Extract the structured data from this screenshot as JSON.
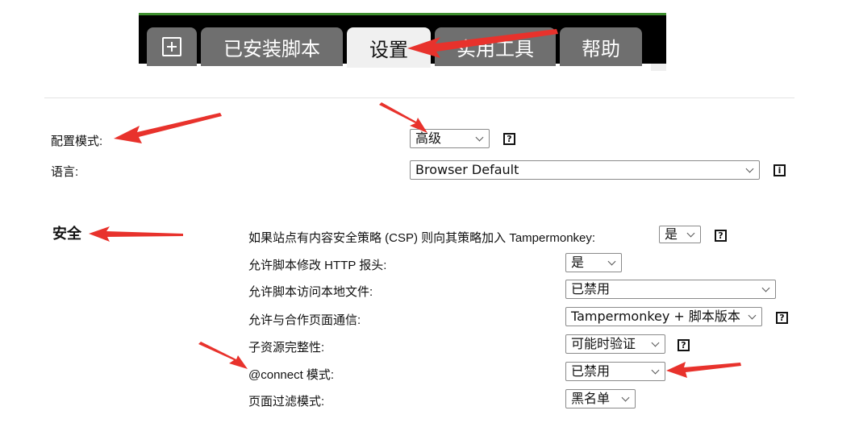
{
  "tabs": {
    "add_icon": "plus-square-icon",
    "installed": "已安装脚本",
    "settings": "设置",
    "utilities": "实用工具",
    "help": "帮助",
    "active": "设置"
  },
  "general": {
    "config_mode_label": "配置模式:",
    "config_mode_value": "高级",
    "language_label": "语言:",
    "language_value": "Browser Default"
  },
  "security": {
    "title": "安全",
    "csp_label": "如果站点有内容安全策略 (CSP) 则向其策略加入 Tampermonkey:",
    "csp_value": "是",
    "http_headers_label": "允许脚本修改 HTTP 报头:",
    "http_headers_value": "是",
    "local_files_label": "允许脚本访问本地文件:",
    "local_files_value": "已禁用",
    "cooperate_label": "允许与合作页面通信:",
    "cooperate_value": "Tampermonkey + 脚本版本",
    "sri_label": "子资源完整性:",
    "sri_value": "可能时验证",
    "connect_label": "@connect 模式:",
    "connect_value": "已禁用",
    "filter_label": "页面过滤模式:",
    "filter_value": "黑名单"
  },
  "help_glyph": "?",
  "info_glyph": "i",
  "colors": {
    "tabbar_bg": "#000000",
    "tabbar_top": "#3f8f2f",
    "tab_inactive": "#6f6f6f",
    "tab_active": "#f0f0f0",
    "annotation_arrow": "#e8322c"
  }
}
